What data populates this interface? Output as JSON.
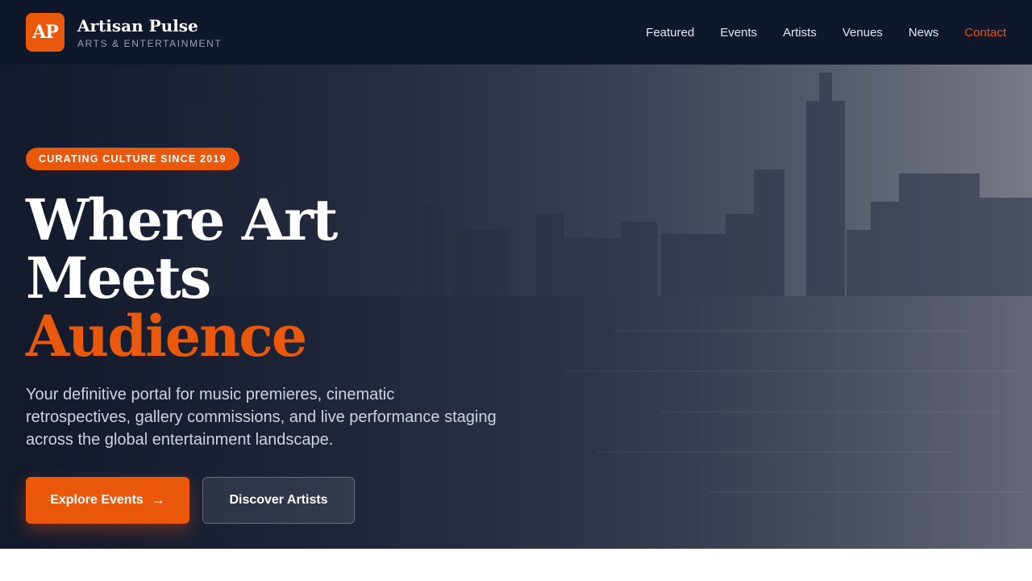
{
  "brand": {
    "logo_text": "AP",
    "name": "Artisan Pulse",
    "tagline": "ARTS & ENTERTAINMENT"
  },
  "nav": {
    "items": [
      {
        "label": "Featured"
      },
      {
        "label": "Events"
      },
      {
        "label": "Artists"
      },
      {
        "label": "Venues"
      },
      {
        "label": "News"
      },
      {
        "label": "Contact",
        "active": true
      }
    ]
  },
  "hero": {
    "badge": "CURATING CULTURE SINCE 2019",
    "headline_line1": "Where Art Meets",
    "headline_line2": "Audience",
    "description": "Your definitive portal for music premieres, cinematic retrospectives, gallery commissions, and live performance staging across the global entertainment landscape.",
    "primary_button": {
      "label": "Explore Events",
      "icon": "arrow-right-icon"
    },
    "secondary_button": {
      "label": "Discover Artists"
    },
    "background": "city-skyline-waterfront-photo"
  },
  "colors": {
    "accent": "#ea580c",
    "header_bg": "#0f172a",
    "text_muted": "#94a3b8",
    "text_light": "#cbd5e1"
  }
}
